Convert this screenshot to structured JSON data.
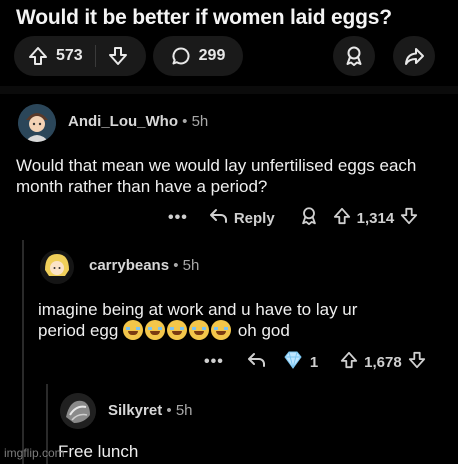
{
  "post": {
    "title": "Would it be better if women laid eggs?",
    "upvotes": "573",
    "comments": "299"
  },
  "comments": [
    {
      "username": "Andi_Lou_Who",
      "separator": "•",
      "age": "5h",
      "text": "Would that mean we would lay unfertilised eggs each month rather than have a period?",
      "reply_label": "Reply",
      "score": "1,314"
    },
    {
      "username": "carrybeans",
      "separator": "•",
      "age": "5h",
      "text_before": "imagine being at work and u have to lay ur period egg",
      "text_after": "oh god",
      "award_count": "1",
      "score": "1,678"
    },
    {
      "username": "Silkyret",
      "separator": "•",
      "age": "5h",
      "text": "Free lunch"
    }
  ],
  "watermark": "imgflip.com",
  "icons": {
    "upvote": "upvote-arrow-icon",
    "downvote": "downvote-arrow-icon",
    "comment": "comment-bubble-icon",
    "award": "award-icon",
    "share": "share-icon",
    "reply": "reply-arrow-icon",
    "more": "more-dots-icon",
    "diamond": "diamond-award-icon"
  },
  "colors": {
    "background": "#000000",
    "pill": "#1a1a1a",
    "text": "#efefef",
    "muted": "#a8a8a8"
  }
}
